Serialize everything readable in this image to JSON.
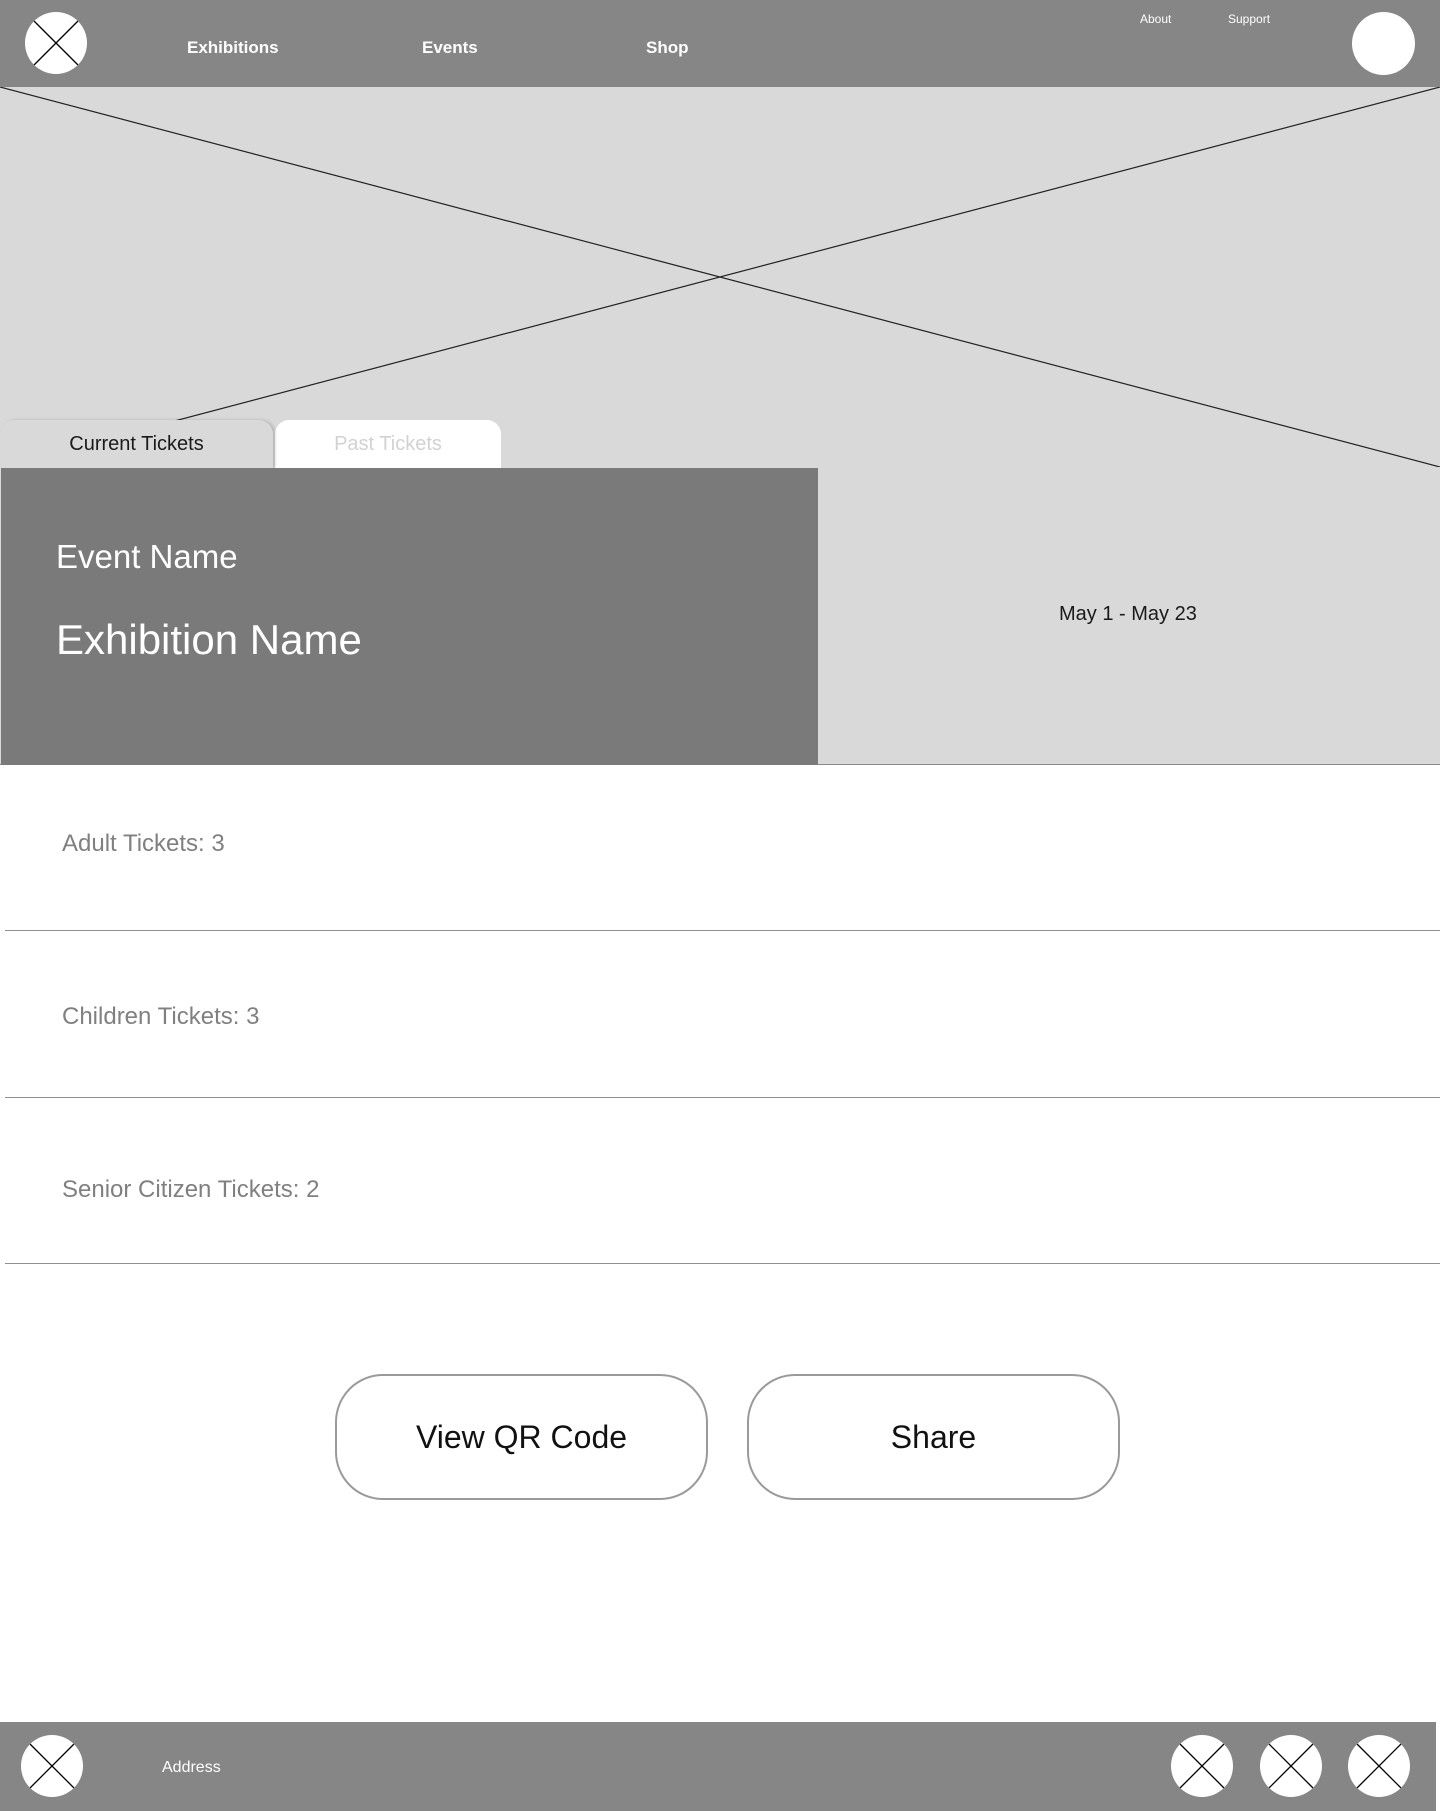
{
  "header": {
    "logo_icon": "placeholder-x-icon",
    "nav": {
      "exhibitions": "Exhibitions",
      "events": "Events",
      "shop": "Shop"
    },
    "utility": {
      "about": "About",
      "support": "Support"
    },
    "avatar_icon": "user-avatar"
  },
  "hero": {
    "image_icon": "image-placeholder",
    "tabs": {
      "current": "Current Tickets",
      "past": "Past Tickets"
    },
    "event_name": "Event Name",
    "exhibition_name": "Exhibition Name",
    "date_range": "May 1 - May 23"
  },
  "tickets": {
    "adult": "Adult Tickets: 3",
    "children": "Children Tickets: 3",
    "senior": "Senior Citizen Tickets: 2"
  },
  "actions": {
    "view_qr": "View QR Code",
    "share": "Share"
  },
  "footer": {
    "address": "Address",
    "social_icons": [
      "placeholder-x-icon",
      "placeholder-x-icon",
      "placeholder-x-icon"
    ]
  },
  "colors": {
    "header_bg": "#868686",
    "hero_bg": "#d9d9d9",
    "event_panel_bg": "#7a7a7a",
    "muted_text": "#808080"
  }
}
